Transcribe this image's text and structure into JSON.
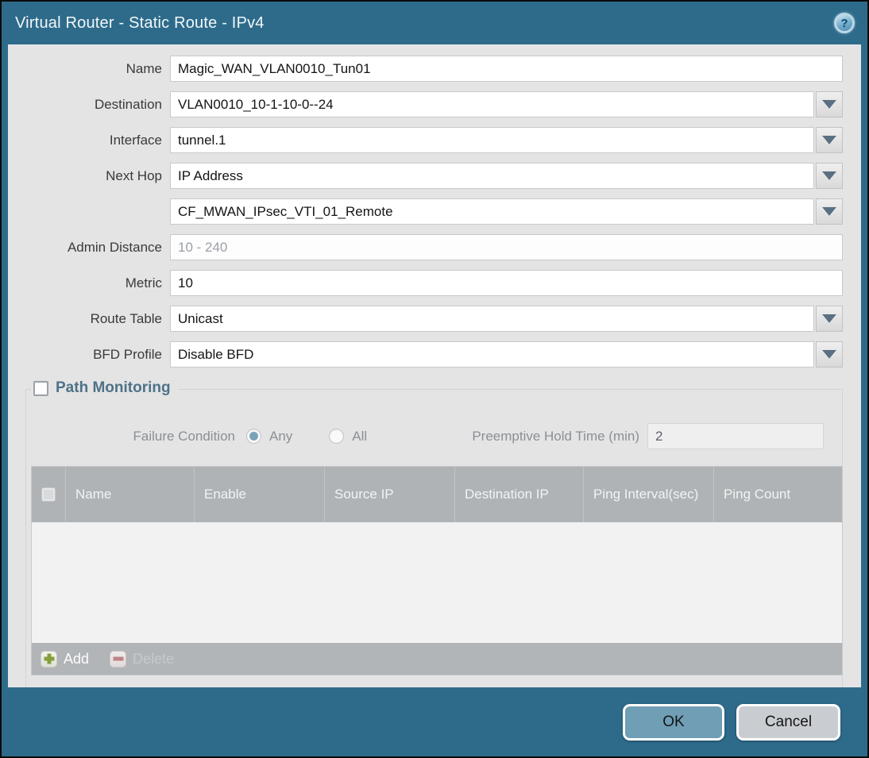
{
  "dialog": {
    "title": "Virtual Router - Static Route - IPv4",
    "help_glyph": "?"
  },
  "form": {
    "name": {
      "label": "Name",
      "value": "Magic_WAN_VLAN0010_Tun01"
    },
    "destination": {
      "label": "Destination",
      "value": "VLAN0010_10-1-10-0--24"
    },
    "interface": {
      "label": "Interface",
      "value": "tunnel.1"
    },
    "next_hop": {
      "label": "Next Hop",
      "value": "IP Address"
    },
    "next_hop_address": {
      "value": "CF_MWAN_IPsec_VTI_01_Remote"
    },
    "admin_distance": {
      "label": "Admin Distance",
      "placeholder": "10 - 240"
    },
    "metric": {
      "label": "Metric",
      "value": "10"
    },
    "route_table": {
      "label": "Route Table",
      "value": "Unicast"
    },
    "bfd_profile": {
      "label": "BFD Profile",
      "value": "Disable BFD"
    }
  },
  "path_monitoring": {
    "legend": "Path Monitoring",
    "failure_condition_label": "Failure Condition",
    "radio_any_label": "Any",
    "radio_all_label": "All",
    "preemptive_label": "Preemptive Hold Time (min)",
    "preemptive_value": "2",
    "table": {
      "columns": [
        "Name",
        "Enable",
        "Source IP",
        "Destination IP",
        "Ping Interval(sec)",
        "Ping Count"
      ],
      "rows": [],
      "add_label": "Add",
      "delete_label": "Delete"
    }
  },
  "footer": {
    "ok_label": "OK",
    "cancel_label": "Cancel"
  },
  "colors": {
    "frame_teal": "#2e6b8b",
    "body_gray": "#e4e4e5",
    "legend_slate": "#4e7287",
    "table_header_gray": "#afb3b6",
    "ok_button_blue": "#6f9eb5",
    "cancel_button_gray": "#c9cdd1",
    "add_icon_green": "#84a03b",
    "delete_icon_red": "#bd8484",
    "radio_selected_blue": "#7ba3b8"
  }
}
